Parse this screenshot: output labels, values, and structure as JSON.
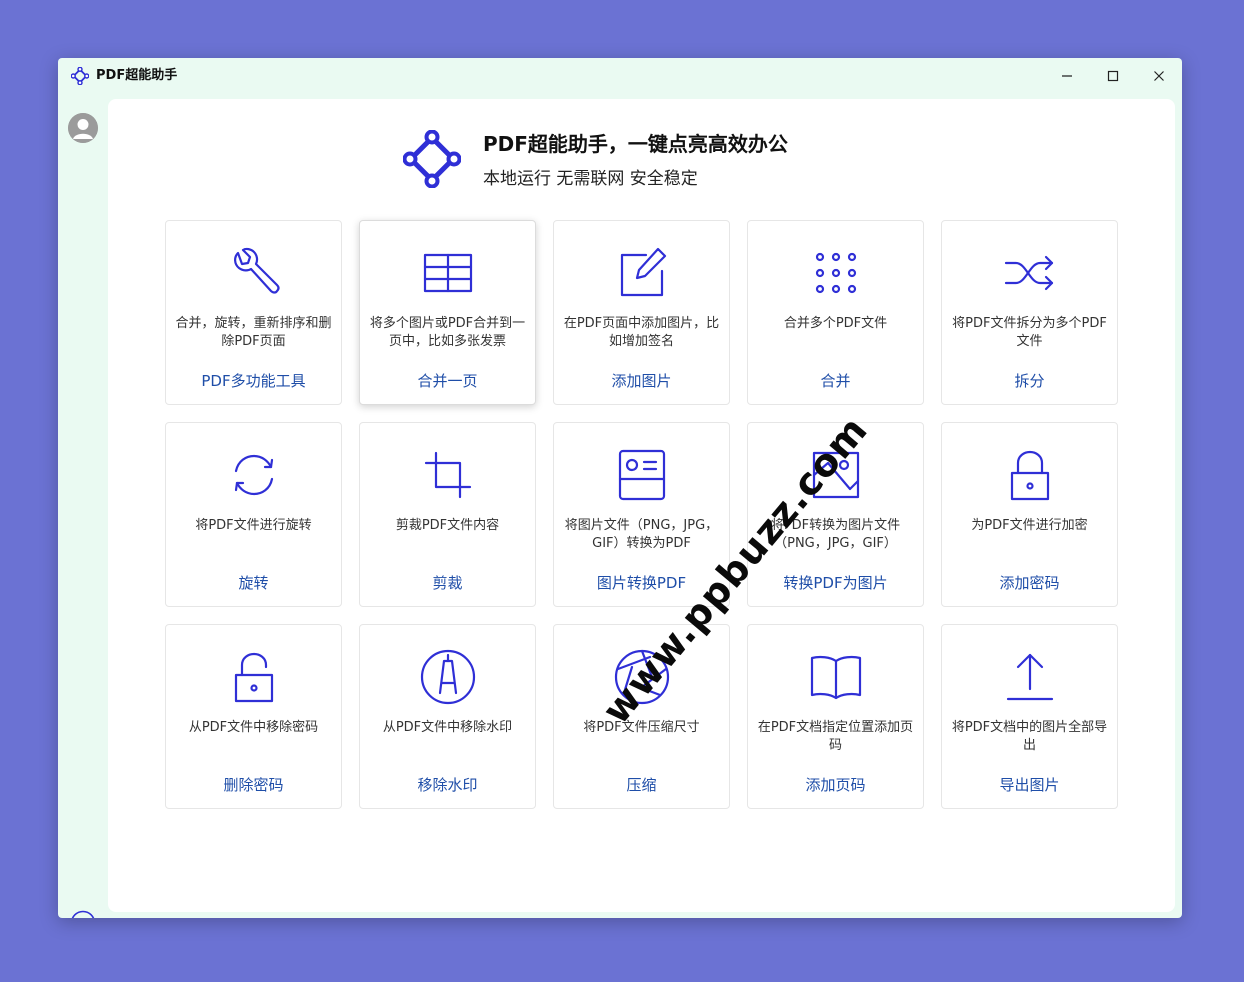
{
  "window": {
    "title": "PDF超能助手"
  },
  "hero": {
    "title": "PDF超能助手，一键点亮高效办公",
    "subtitle": "本地运行 无需联网 安全稳定"
  },
  "colors": {
    "accent": "#2f2fd6",
    "label": "#1f4ea8",
    "background": "#6b72d3",
    "sidebar": "#eafaf2"
  },
  "tools": [
    {
      "icon": "wrench-icon",
      "desc": "合并，旋转，重新排序和删除PDF页面",
      "label": "PDF多功能工具"
    },
    {
      "icon": "grid-table-icon",
      "desc": "将多个图片或PDF合并到一页中，比如多张发票",
      "label": "合并一页"
    },
    {
      "icon": "edit-image-icon",
      "desc": "在PDF页面中添加图片，比如增加签名",
      "label": "添加图片"
    },
    {
      "icon": "dots-grid-icon",
      "desc": "合并多个PDF文件",
      "label": "合并"
    },
    {
      "icon": "shuffle-icon",
      "desc": "将PDF文件拆分为多个PDF文件",
      "label": "拆分"
    },
    {
      "icon": "rotate-icon",
      "desc": "将PDF文件进行旋转",
      "label": "旋转"
    },
    {
      "icon": "crop-icon",
      "desc": "剪裁PDF文件内容",
      "label": "剪裁"
    },
    {
      "icon": "id-card-icon",
      "desc": "将图片文件（PNG，JPG，GIF）转换为PDF",
      "label": "图片转换PDF"
    },
    {
      "icon": "picture-icon",
      "desc": "将PDF转换为图片文件（PNG，JPG，GIF）",
      "label": "转换PDF为图片"
    },
    {
      "icon": "lock-icon",
      "desc": "为PDF文件进行加密",
      "label": "添加密码"
    },
    {
      "icon": "unlock-icon",
      "desc": "从PDF文件中移除密码",
      "label": "删除密码"
    },
    {
      "icon": "pen-nib-icon",
      "desc": "从PDF文件中移除水印",
      "label": "移除水印"
    },
    {
      "icon": "aperture-icon",
      "desc": "将PDF文件压缩尺寸",
      "label": "压缩"
    },
    {
      "icon": "book-icon",
      "desc": "在PDF文档指定位置添加页码",
      "label": "添加页码"
    },
    {
      "icon": "upload-icon",
      "desc": "将PDF文档中的图片全部导出",
      "label": "导出图片"
    }
  ],
  "watermark": "www.ppbuzz.com"
}
